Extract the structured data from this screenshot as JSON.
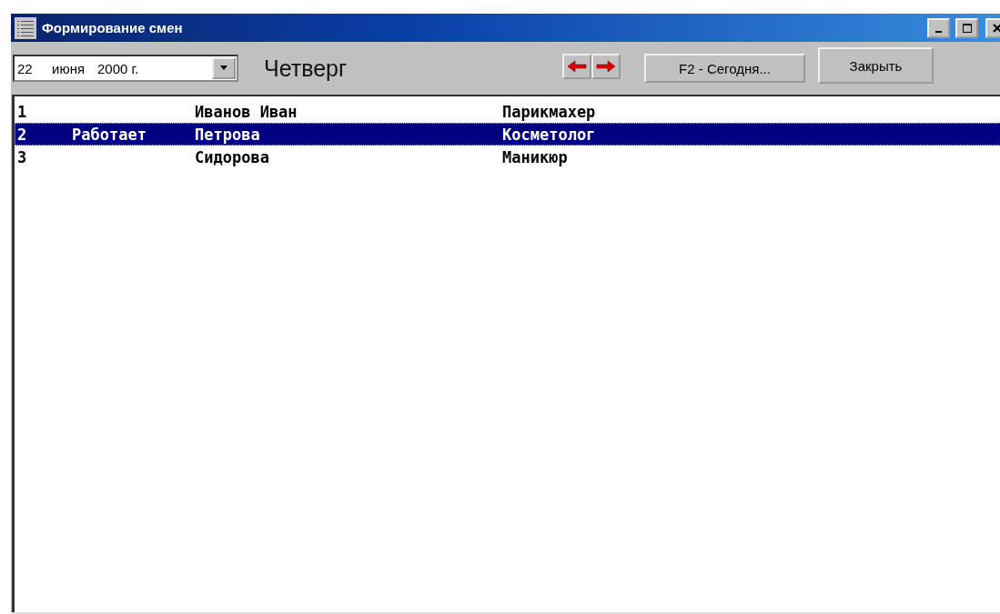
{
  "window": {
    "title": "Формирование смен"
  },
  "toolbar": {
    "date": {
      "day": "22",
      "month": "июня",
      "year": "2000 г."
    },
    "weekday": "Четверг",
    "today_button": "F2 - Сегодня...",
    "close_button": "Закрыть"
  },
  "rows": [
    {
      "number": "1",
      "status": "",
      "name": "Иванов Иван",
      "role": "Парикмахер",
      "selected": false
    },
    {
      "number": "2",
      "status": "Работает",
      "name": "Петрова",
      "role": "Косметолог",
      "selected": true
    },
    {
      "number": "3",
      "status": "",
      "name": "Сидорова",
      "role": "Маникюр",
      "selected": false
    }
  ]
}
